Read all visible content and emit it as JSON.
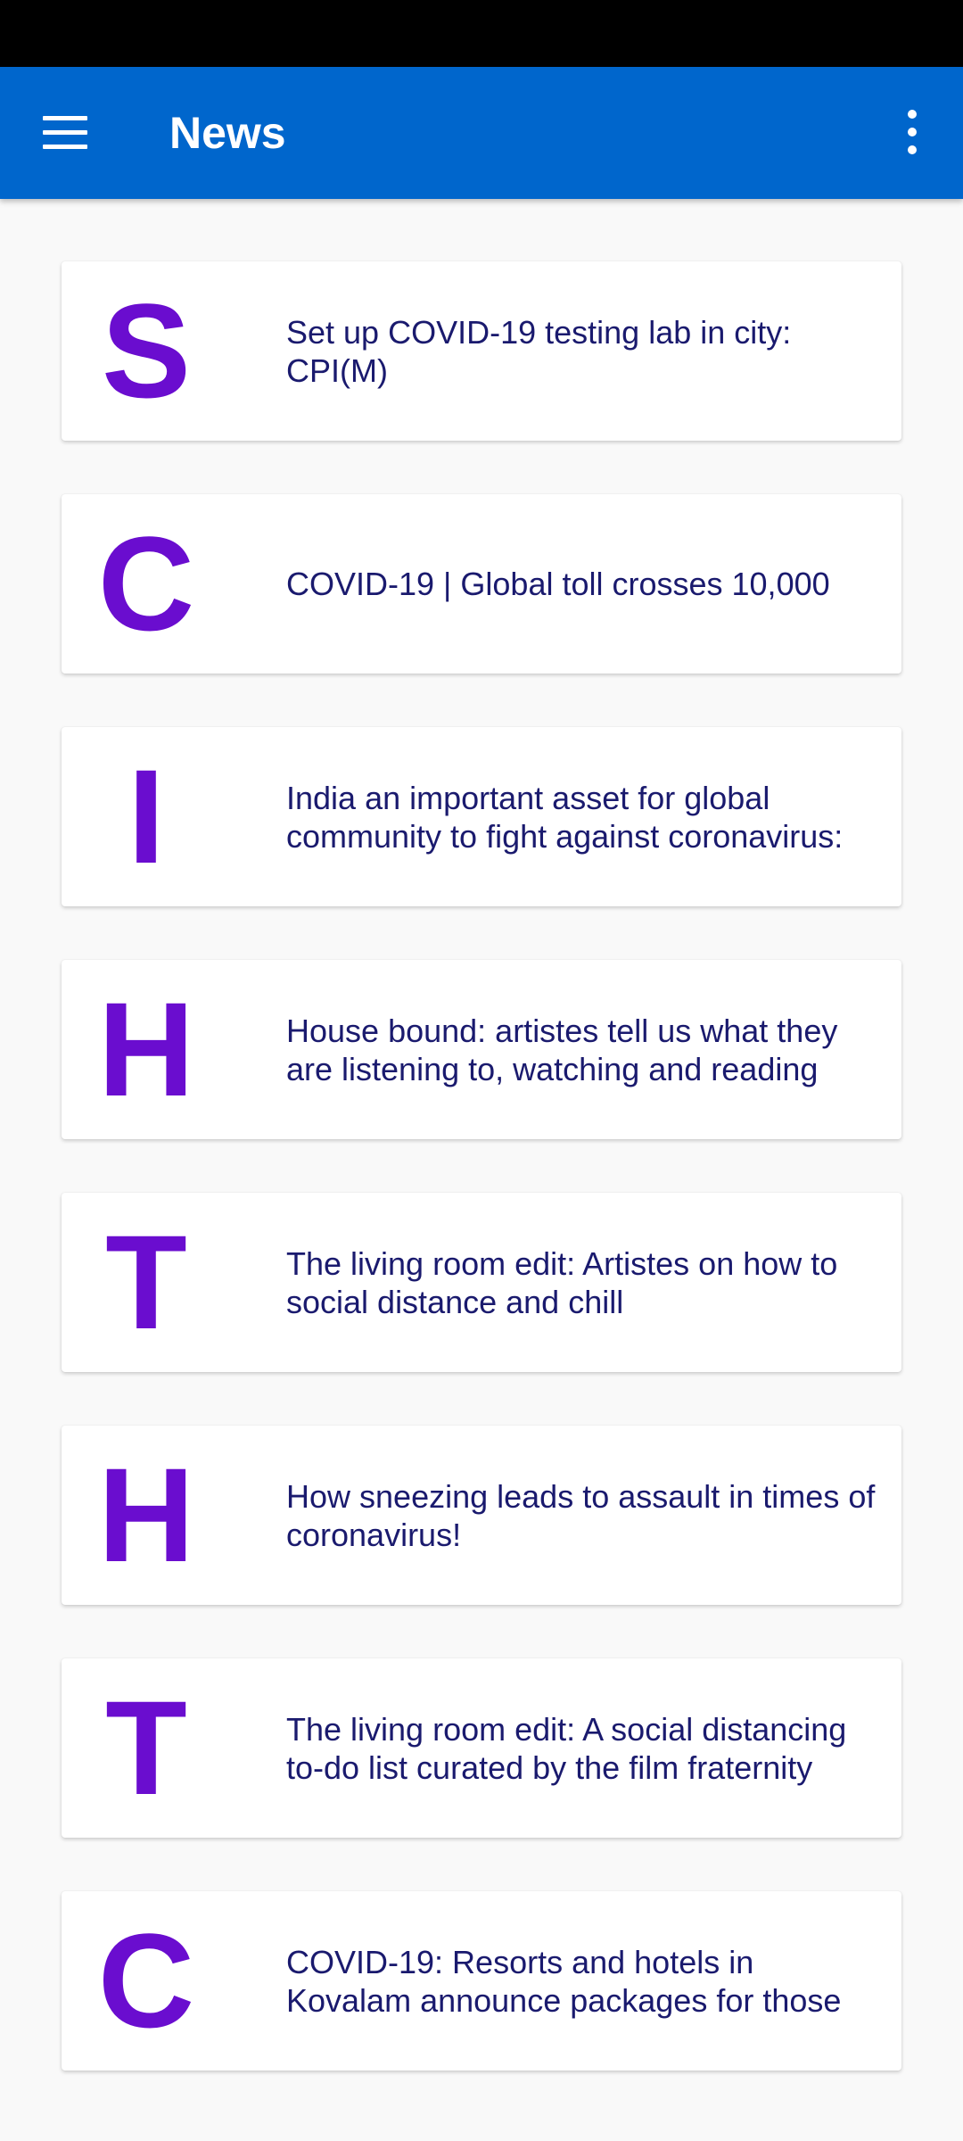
{
  "app_bar": {
    "title": "News",
    "color": "#0066cc"
  },
  "accent_color": "#6a0dcf",
  "articles": [
    {
      "letter": "S",
      "title": "Set up COVID-19 testing lab in city: CPI(M)"
    },
    {
      "letter": "C",
      "title": "COVID-19 | Global toll crosses 10,000"
    },
    {
      "letter": "I",
      "title": "India an important asset for global community to fight against coronavirus:"
    },
    {
      "letter": "H",
      "title": "House bound: artistes tell us what they are listening to, watching and reading"
    },
    {
      "letter": "T",
      "title": "The living room edit: Artistes on how to social distance and chill"
    },
    {
      "letter": "H",
      "title": "How sneezing leads to assault in times of coronavirus!"
    },
    {
      "letter": "T",
      "title": "The living room edit: A social distancing to-do list curated by the film fraternity"
    },
    {
      "letter": "C",
      "title": "COVID-19: Resorts and hotels in Kovalam announce packages for those"
    }
  ]
}
